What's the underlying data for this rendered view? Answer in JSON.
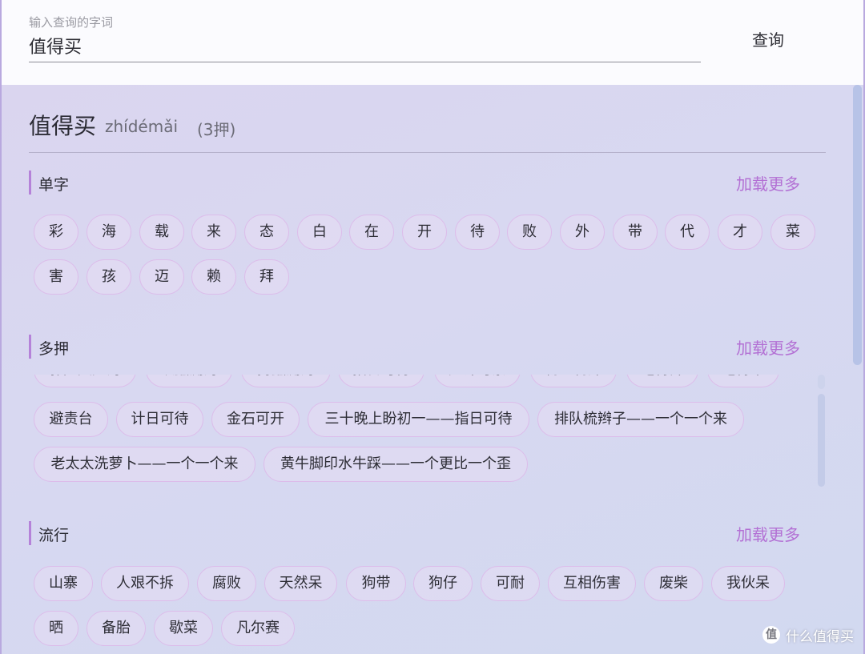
{
  "search": {
    "label": "输入查询的字词",
    "value": "值得买",
    "button_label": "查询"
  },
  "word": {
    "title": "值得买",
    "pinyin": "zhídémǎi",
    "rhyme_count": "(3押)"
  },
  "sections": {
    "single": {
      "title": "单字",
      "load_more": "加载更多",
      "chips": [
        "彩",
        "海",
        "载",
        "来",
        "态",
        "白",
        "在",
        "开",
        "待",
        "败",
        "外",
        "带",
        "代",
        "才",
        "菜",
        "害",
        "孩",
        "迈",
        "赖",
        "拜"
      ]
    },
    "multi": {
      "title": "多押",
      "load_more": "加载更多",
      "partial_chips": [
        "郭隆灭无海",
        "以蠡测海",
        "持蠡测海",
        "指日可待",
        "无计可柰",
        "物壁物外",
        "吃得开",
        "吃得来"
      ],
      "chips": [
        "避责台",
        "计日可待",
        "金石可开",
        "三十晚上盼初一——指日可待",
        "排队梳辫子——一个一个来",
        "老太太洗萝卜——一个一个来",
        "黄牛脚印水牛踩——一个更比一个歪"
      ]
    },
    "popular": {
      "title": "流行",
      "load_more": "加载更多",
      "chips": [
        "山寨",
        "人艰不拆",
        "腐败",
        "天然呆",
        "狗带",
        "狗仔",
        "可耐",
        "互相伤害",
        "废柴",
        "我伙呆",
        "晒",
        "备胎",
        "歇菜",
        "凡尔赛"
      ]
    }
  },
  "watermark": {
    "icon": "值",
    "text": "什么值得买"
  }
}
